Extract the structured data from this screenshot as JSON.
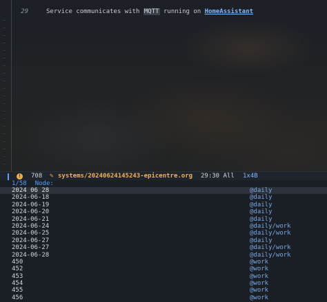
{
  "editor": {
    "line_number": "29",
    "text_before": "Service communicates with ",
    "text_mqtt": "MQTT",
    "text_middle": " running on ",
    "link_text": "HomeAssistant"
  },
  "modeline": {
    "badge": "!",
    "count": "708",
    "file_icon": "edit-file-icon",
    "filename": "systems/20240624145243-epicentre.org",
    "position": "29:30 All",
    "encoding": "1x4B"
  },
  "list": {
    "counter": "1/58",
    "prompt": "Node:",
    "rows": [
      {
        "title": "2024 06 28",
        "tag": "@daily"
      },
      {
        "title": "2024-06-18",
        "tag": "@daily"
      },
      {
        "title": "2024-06-19",
        "tag": "@daily"
      },
      {
        "title": "2024-06-20",
        "tag": "@daily"
      },
      {
        "title": "2024-06-21",
        "tag": "@daily"
      },
      {
        "title": "2024-06-24",
        "tag": "@daily/work"
      },
      {
        "title": "2024-06-25",
        "tag": "@daily/work"
      },
      {
        "title": "2024-06-27",
        "tag": "@daily"
      },
      {
        "title": "2024-06-27",
        "tag": "@daily/work"
      },
      {
        "title": "2024-06-28",
        "tag": "@daily/work"
      },
      {
        "title": "450",
        "tag": "@work"
      },
      {
        "title": "452",
        "tag": "@work"
      },
      {
        "title": "453",
        "tag": "@work"
      },
      {
        "title": "454",
        "tag": "@work"
      },
      {
        "title": "455",
        "tag": "@work"
      },
      {
        "title": "456",
        "tag": "@work"
      }
    ]
  },
  "colors": {
    "accent": "#5aa0ff",
    "filename": "#f0b25a",
    "tag": "#7aa9e6"
  }
}
